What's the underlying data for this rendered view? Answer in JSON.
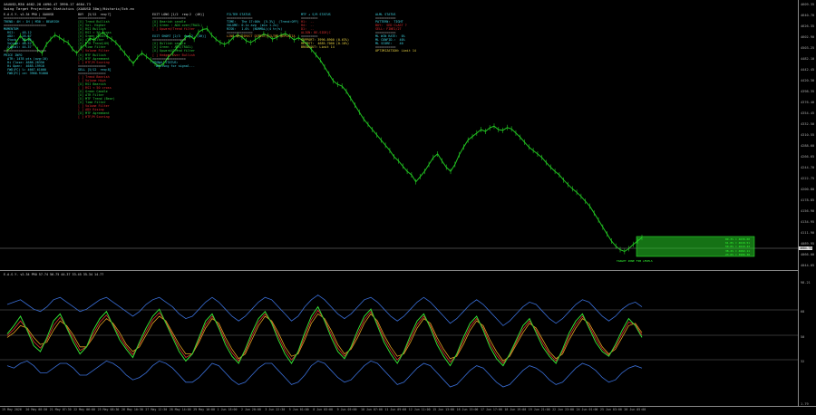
{
  "header": {
    "symbol_line": "XAUUSD,M30  4682.28 4690.47 3990.17 4684.73",
    "indicator_name": "Swing Target Projection Statistics (XAUUSD 30m)/Historic/3ch.ex"
  },
  "osc_header": "E.A.S.Y. v2.34 PRO 57.74 56.75 44.37 33.45 35.34 14.77",
  "price_axis": [
    "4609.35",
    "4640.70",
    "4626.35",
    "4602.90",
    "4503.25",
    "4482.10",
    "4442.45",
    "4420.30",
    "4398.35",
    "4376.40",
    "4354.45",
    "4332.50",
    "4310.55",
    "4288.60",
    "4266.65",
    "4244.70",
    "4222.75",
    "4200.80",
    "4178.85",
    "4156.90",
    "4134.95",
    "4111.90",
    "4089.95",
    "4066.00",
    "4044.05"
  ],
  "osc_axis": [
    "98.21",
    "68",
    "50",
    "32",
    "1.79"
  ],
  "current_price": "4684.73",
  "time_axis": [
    "19 May 2026",
    "20 May 08:30",
    "21 May 07:30",
    "22 May 06:00",
    "25 May 08:30",
    "26 May 10:30",
    "27 May 12:30",
    "28 May 14:00",
    "29 May 16:00",
    "1 Jun 18:00",
    "2 Jun 20:00",
    "3 Jun 22:30",
    "5 Jun 01:00",
    "8 Jun 03:00",
    "9 Jun 05:00",
    "10 Jun 07:00",
    "11 Jun 09:00",
    "12 Jun 11:00",
    "15 Jun 13:00",
    "16 Jun 15:00",
    "17 Jun 17:00",
    "18 Jun 19:00",
    "19 Jun 21:00",
    "22 Jun 23:00",
    "24 Jun 01:00",
    "25 Jun 03:00",
    "26 Jun 05:00"
  ],
  "panels": {
    "easy": [
      "E.A.S.Y. v2.34 PRO | XAUUSD",
      "=======================",
      "TREND: 4H : 1H | M30 : BEARISH",
      "=======================",
      "MOMENTUM",
      "  RSI:    48.12",
      "  ADX:    28.67",
      "  Stoch:  31.55",
      "  Volume: 48.52",
      "  Signal: 44.37",
      "=======================",
      "PRICE INFO",
      "  ATR: 1478 pts (avg:10)",
      "  Hi Close: 4686.28350",
      "  Hi Open:  4685.19910",
      "  FWD(FC) %: 4667.61000",
      "  FWD(FC) ce: 3966.91000"
    ],
    "buy": [
      "BUY  [5/12  req:7]",
      "===============",
      "[X] Trend Bullish",
      "[X] Vol. Higher",
      "[X] RSI Bullish",
      "[X] RSI > 50 cross",
      "[X] Green Candle",
      "[X] ATR Filter",
      "[X] ATR Trend(4H)",
      "[X] Time Filter",
      "[ ] Volume Filter",
      "[X] MTF Bullish",
      "[X] MTF Agreement",
      "[ ] HTF/M Scoring",
      "===============",
      "SELL [5/12  req:8]",
      "===============",
      "[ ] Trend Bearish",
      "[ ] Volume High",
      "[X] RSI Bearish",
      "[ ] RSI < 50 cross",
      "[X] Green Candle",
      "[X] ATR Filter",
      "[X] MTF Trend (Bear)",
      "[X] Time Filter",
      "[ ] Volume Filter",
      "[ ] ADX Rising",
      "[X] MTF Agreement",
      "[ ] HTF/M Scoring"
    ],
    "exits": [
      "EXIT LONG [1/2  req:2  (4H)]",
      "==================",
      "[X] Bearish candle",
      "[X] Green : ADX over(TRAIL)",
      "[ ] Upward/Trend filter",
      "",
      "EXIT SHORT [2/3  req:2  (4H)]",
      "==================",
      "[X] Bullish candle",
      "[X] Green : ADX(TRAIL)",
      "[X] Upward/Trend filter",
      "[ ] Hedged Over Bullish",
      "==================",
      "SIGNAL STATUS:",
      "  Waiting for signal..."
    ],
    "filter": [
      "FILTER STATUS",
      "==============",
      "TIME:   The 17:00h  [5.3%]  (Trend:OFF)",
      "VOLUME: 0.1x avg  (min 1.2x)",
      "RISK:   1.0%  (NORMAL)(4 tr/s)",
      "==============",
      "LINE UP/DIRECT DIRECT/FILTRE REPLATIA"
    ],
    "mtf": [
      "MTF + S/R STATUS",
      "=========",
      "H1:  --",
      "H4:  --",
      "D1:  --",
      "ALIGN: BE-SIDE|C",
      "=========",
      "SUPPORT: 3996.8900 (0.63%)",
      "RESIST:  4685.7000 (0.18%)",
      "BREAKOUT: Limit 14"
    ],
    "ml": [
      "ALML STATUS",
      "===========",
      "PATTERN:  TIGHT",
      "BUY:  SED CLAST ?",
      "SELL: FINE1/27",
      "===========",
      "ML WIN RATE:  0%",
      "ML CONFID.:  40%",
      "ML SCORE:    40",
      "===========",
      "OPTIMIZATION: Limit 14"
    ]
  },
  "target_zone": {
    "labels": [
      "89.3% = 4638.00",
      "61.8% = 4618.51",
      "50.0% = 4610.43",
      "38.2% = 4602.11",
      "23.6% = 3996.38"
    ],
    "bottom_label": "TARGET ZONE FIB LEVELS"
  },
  "price_series": [
    4568,
    4578,
    4590,
    4610,
    4595,
    4602,
    4588,
    4570,
    4560,
    4585,
    4600,
    4612,
    4605,
    4596,
    4590,
    4572,
    4560,
    4575,
    4585,
    4602,
    4598,
    4610,
    4620,
    4608,
    4600,
    4590,
    4575,
    4560,
    4545,
    4530,
    4548,
    4560,
    4550,
    4540,
    4530,
    4522,
    4530,
    4548,
    4560,
    4575,
    4590,
    4605,
    4610,
    4600,
    4620,
    4628,
    4630,
    4612,
    4600,
    4590,
    4585,
    4592,
    4605,
    4612,
    4606,
    4595,
    4590,
    4598,
    4606,
    4615,
    4610,
    4600,
    4605,
    4612,
    4616,
    4608,
    4598,
    4604,
    4596,
    4585,
    4570,
    4555,
    4540,
    4520,
    4500,
    4480,
    4470,
    4465,
    4450,
    4430,
    4410,
    4390,
    4370,
    4355,
    4340,
    4325,
    4310,
    4295,
    4280,
    4262,
    4250,
    4235,
    4220,
    4210,
    4190,
    4205,
    4220,
    4240,
    4260,
    4270,
    4250,
    4232,
    4220,
    4240,
    4268,
    4290,
    4310,
    4320,
    4330,
    4340,
    4335,
    4345,
    4350,
    4340,
    4338,
    4346,
    4342,
    4330,
    4318,
    4304,
    4290,
    4280,
    4270,
    4260,
    4245,
    4232,
    4220,
    4210,
    4195,
    4182,
    4170,
    4160,
    4148,
    4134,
    4120,
    4100,
    4080,
    4060,
    4040,
    4020,
    4005,
    3995,
    3990,
    3998,
    4010,
    4020,
    4030
  ],
  "osc_series": {
    "fast": [
      55,
      62,
      70,
      58,
      45,
      40,
      52,
      66,
      72,
      60,
      48,
      38,
      44,
      58,
      68,
      74,
      62,
      50,
      42,
      35,
      48,
      60,
      70,
      76,
      64,
      52,
      40,
      32,
      38,
      52,
      66,
      72,
      60,
      46,
      36,
      30,
      42,
      56,
      68,
      74,
      64,
      50,
      38,
      30,
      40,
      56,
      70,
      78,
      66,
      52,
      40,
      34,
      44,
      58,
      70,
      76,
      62,
      48,
      38,
      30,
      40,
      54,
      66,
      72,
      60,
      46,
      36,
      28,
      38,
      52,
      64,
      70,
      58,
      44,
      34,
      28,
      38,
      50,
      62,
      68,
      56,
      44,
      36,
      30,
      42,
      56,
      66,
      72,
      60,
      48,
      40,
      36,
      46,
      58,
      68,
      62,
      52
    ],
    "slow": [
      52,
      56,
      62,
      60,
      52,
      46,
      48,
      58,
      66,
      62,
      54,
      44,
      44,
      52,
      62,
      68,
      64,
      56,
      46,
      40,
      44,
      54,
      64,
      70,
      66,
      56,
      46,
      38,
      38,
      48,
      60,
      68,
      64,
      52,
      42,
      34,
      38,
      50,
      62,
      70,
      66,
      56,
      44,
      36,
      38,
      50,
      64,
      72,
      68,
      58,
      46,
      38,
      42,
      52,
      64,
      72,
      66,
      54,
      44,
      36,
      38,
      48,
      60,
      68,
      64,
      52,
      42,
      34,
      36,
      46,
      58,
      66,
      62,
      50,
      40,
      32,
      36,
      46,
      56,
      64,
      60,
      50,
      40,
      34,
      38,
      50,
      60,
      68,
      64,
      54,
      44,
      38,
      42,
      52,
      62,
      64,
      56
    ],
    "band_hi": [
      80,
      82,
      84,
      80,
      76,
      74,
      78,
      84,
      86,
      82,
      78,
      74,
      76,
      80,
      84,
      86,
      82,
      78,
      74,
      70,
      74,
      80,
      84,
      86,
      82,
      78,
      72,
      68,
      70,
      76,
      82,
      86,
      82,
      76,
      70,
      66,
      70,
      76,
      82,
      86,
      84,
      78,
      72,
      66,
      70,
      78,
      84,
      88,
      84,
      78,
      72,
      68,
      72,
      78,
      84,
      86,
      82,
      76,
      70,
      66,
      70,
      76,
      82,
      86,
      82,
      76,
      70,
      64,
      68,
      74,
      80,
      84,
      80,
      74,
      68,
      62,
      66,
      72,
      78,
      82,
      80,
      74,
      68,
      64,
      68,
      74,
      80,
      84,
      82,
      76,
      70,
      66,
      70,
      76,
      80,
      82,
      78
    ],
    "band_lo": [
      28,
      26,
      30,
      32,
      28,
      22,
      22,
      26,
      30,
      30,
      26,
      20,
      20,
      24,
      28,
      32,
      30,
      26,
      20,
      16,
      18,
      22,
      28,
      32,
      30,
      26,
      20,
      14,
      14,
      18,
      24,
      30,
      28,
      22,
      16,
      12,
      14,
      20,
      26,
      30,
      30,
      24,
      18,
      12,
      14,
      20,
      28,
      32,
      30,
      24,
      18,
      14,
      16,
      22,
      28,
      32,
      30,
      24,
      18,
      12,
      14,
      20,
      26,
      30,
      28,
      22,
      16,
      10,
      12,
      18,
      24,
      28,
      26,
      20,
      14,
      10,
      12,
      18,
      24,
      28,
      26,
      22,
      16,
      12,
      14,
      20,
      26,
      30,
      28,
      24,
      18,
      14,
      16,
      22,
      26,
      28,
      26
    ]
  },
  "colors": {
    "price": "#22c422",
    "zone": "#26d026",
    "osc_fast": "#33dd33",
    "osc_mid": "#e03030",
    "osc_slow": "#e0a020",
    "band": "#3a6fd8"
  }
}
